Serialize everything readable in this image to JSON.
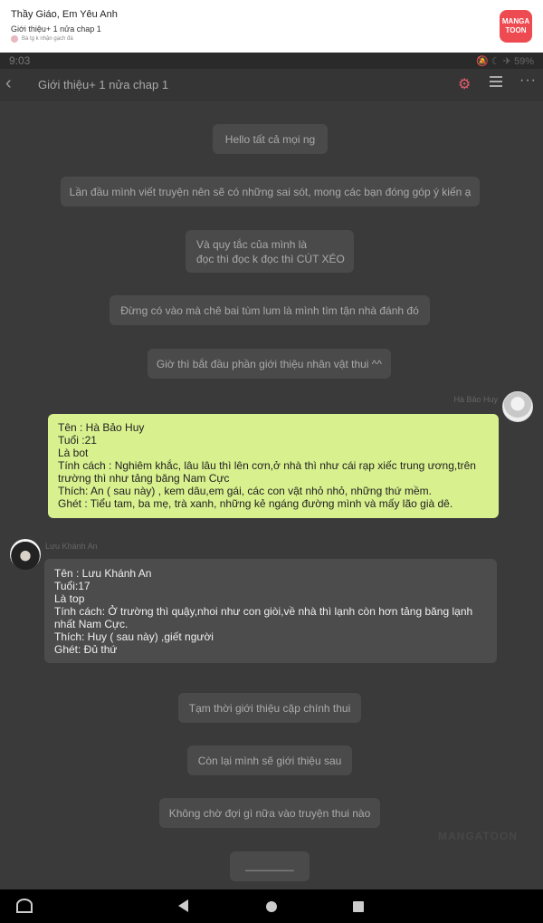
{
  "notification": {
    "title": "Thầy Giáo, Em Yêu Anh",
    "subtitle": "Giới thiệu+ 1 nửa chap 1",
    "meta": "Bà tg k nhận gạch đá",
    "logo_line1": "MANGA",
    "logo_line2": "TOON",
    "brand_color": "#ee4a52"
  },
  "status_bar": {
    "time": "9:03",
    "battery": "59%"
  },
  "topbar": {
    "title": "Giới thiệu+ 1 nửa chap 1",
    "accent_color": "#e25d6b"
  },
  "narration": [
    "Hello tất cả mọi ng",
    "Lần đầu mình viết truyện nên sẽ có những sai sót, mong các bạn đóng góp ý kiến ạ",
    "Và quy tắc của mình là\nđọc thì đọc k đọc thì CÚT XÉO",
    "Đừng có vào mà chê bai tùm lum là mình tìm tận nhà đánh đó",
    "Giờ thì bắt đầu phần giới thiệu nhân vật thui ^^"
  ],
  "characters": {
    "huy": {
      "name": "Hà Bảo Huy",
      "bubble_color": "#d8f08e",
      "lines": [
        "Tên : Hà Bảo Huy",
        "Tuổi :21",
        "Là bot",
        "Tính cách : Nghiêm khắc, lâu lâu thì lên cơn,ở nhà thì như cái rạp xiếc trung ương,trên trường thì như tảng băng Nam Cực",
        "Thích: An ( sau này) , kem dâu,em gái, các con vật nhỏ nhỏ, những thứ mềm.",
        "Ghét : Tiểu tam, ba mẹ, trà xanh, những kẻ ngáng đường mình và mấy lão già dê."
      ]
    },
    "an": {
      "name": "Lưu Khánh An",
      "bubble_color": "#4c4c4c",
      "lines": [
        "Tên : Lưu Khánh An",
        "Tuổi:17",
        "Là top",
        "Tính cách: Ở trường thì quậy,nhoi như con giòi,về nhà thì lạnh còn hơn tảng băng lạnh nhất Nam Cực.",
        "Thích: Huy ( sau này) ,giết người",
        "Ghét: Đủ thứ"
      ]
    }
  },
  "closing": [
    "Tạm thời giới thiệu cặp chính thui",
    "Còn lại mình sẽ giới thiệu sau",
    "Không chờ đợi gì nữa vào truyện thui nào",
    "________"
  ],
  "watermark": "MANGATOON"
}
